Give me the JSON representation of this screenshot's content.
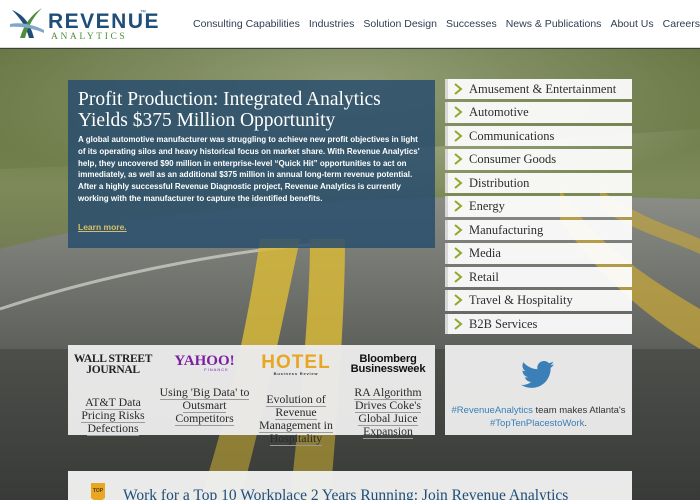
{
  "brand": {
    "name": "REVENUE",
    "trademark": "™",
    "subtitle": "ANALYTICS",
    "colors": {
      "primary": "#1f4e79",
      "accent": "#4f8d3d",
      "link": "#d4c06a"
    }
  },
  "nav": {
    "items": [
      {
        "label": "Consulting Capabilities"
      },
      {
        "label": "Industries"
      },
      {
        "label": "Solution Design"
      },
      {
        "label": "Successes"
      },
      {
        "label": "News & Publications"
      },
      {
        "label": "About Us"
      },
      {
        "label": "Careers"
      }
    ]
  },
  "feature": {
    "title": "Profit Production: Integrated Analytics Yields $375 Million Opportunity",
    "body": "A global automotive manufacturer was struggling to achieve new profit objectives in light of its operating silos and heavy historical focus on market share. With Revenue Analytics' help, they uncovered $90 million in enterprise-level “Quick Hit” opportunities to act on immediately, as well as an additional $375 million in annual long-term revenue potential. After a highly successful Revenue Diagnostic project, Revenue Analytics is currently working with the manufacturer to capture the identified benefits.",
    "link": "Learn more."
  },
  "industries": {
    "items": [
      {
        "label": "Amusement & Entertainment"
      },
      {
        "label": "Automotive"
      },
      {
        "label": "Communications"
      },
      {
        "label": "Consumer Goods"
      },
      {
        "label": "Distribution"
      },
      {
        "label": "Energy"
      },
      {
        "label": "Manufacturing"
      },
      {
        "label": "Media"
      },
      {
        "label": "Retail"
      },
      {
        "label": "Travel & Hospitality"
      },
      {
        "label": "B2B Services"
      }
    ],
    "chevron_color": "#8fa82a"
  },
  "news": {
    "items": [
      {
        "logo_line1": "WALL STREET",
        "logo_line2": "JOURNAL",
        "title": "AT&T Data Pricing Risks Defections"
      },
      {
        "logo_line1": "YAHOO!",
        "logo_line2": "FINANCE",
        "title": "Using 'Big Data' to Outsmart Competitors"
      },
      {
        "logo_line1": "HOTEL",
        "logo_line2": "Business Review",
        "title": "Evolution of Revenue Management in Hospitality"
      },
      {
        "logo_line1": "Bloomberg",
        "logo_line2": "Businessweek",
        "title": "RA Algorithm Drives Coke's Global Juice Expansion"
      }
    ]
  },
  "twitter": {
    "icon": "twitter-bird-icon",
    "hashtag1": "#RevenueAnalytics",
    "middle": " team makes Atlanta's ",
    "hashtag2": "#TopTenPlacestoWork",
    "end": "."
  },
  "banner": {
    "badge": "TOP",
    "text": "Work for a Top 10 Workplace 2 Years Running: Join Revenue Analytics"
  }
}
